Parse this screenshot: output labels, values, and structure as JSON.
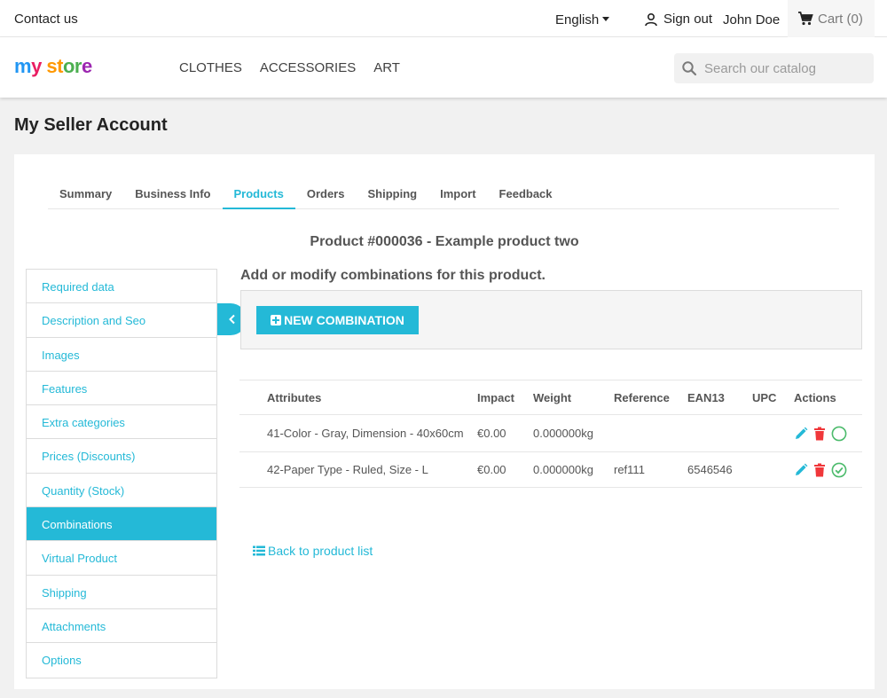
{
  "topbar": {
    "contact": "Contact us",
    "language": "English",
    "sign_out": "Sign out",
    "user_name": "John Doe",
    "cart": "Cart (0)"
  },
  "header": {
    "logo": {
      "p1": "m",
      "p2": "y ",
      "p3": "st",
      "p4": "or",
      "p5": "e"
    },
    "nav": [
      "CLOTHES",
      "ACCESSORIES",
      "ART"
    ],
    "search_placeholder": "Search our catalog"
  },
  "page_title": "My Seller Account",
  "tabs": [
    {
      "label": "Summary",
      "active": false
    },
    {
      "label": "Business Info",
      "active": false
    },
    {
      "label": "Products",
      "active": true
    },
    {
      "label": "Orders",
      "active": false
    },
    {
      "label": "Shipping",
      "active": false
    },
    {
      "label": "Import",
      "active": false
    },
    {
      "label": "Feedback",
      "active": false
    }
  ],
  "product_title": "Product #000036 - Example product two",
  "sidemenu": [
    "Required data",
    "Description and Seo",
    "Images",
    "Features",
    "Extra categories",
    "Prices (Discounts)",
    "Quantity (Stock)",
    "Combinations",
    "Virtual Product",
    "Shipping",
    "Attachments",
    "Options"
  ],
  "sidemenu_active": "Combinations",
  "combinations": {
    "subheading": "Add or modify combinations for this product.",
    "new_button": "NEW COMBINATION",
    "columns": [
      "Attributes",
      "Impact",
      "Weight",
      "Reference",
      "EAN13",
      "UPC",
      "Actions"
    ],
    "rows": [
      {
        "attributes": "41-Color - Gray, Dimension - 40x60cm",
        "impact": "€0.00",
        "weight": "0.000000kg",
        "reference": "",
        "ean13": "",
        "upc": "",
        "default": false
      },
      {
        "attributes": "42-Paper Type - Ruled, Size - L",
        "impact": "€0.00",
        "weight": "0.000000kg",
        "reference": "ref111",
        "ean13": "6546546",
        "upc": "",
        "default": true
      }
    ]
  },
  "back_link": "Back to product list",
  "colors": {
    "accent": "#24b9d7",
    "delete": "#f0373a",
    "default_check": "#4cbb6c"
  }
}
